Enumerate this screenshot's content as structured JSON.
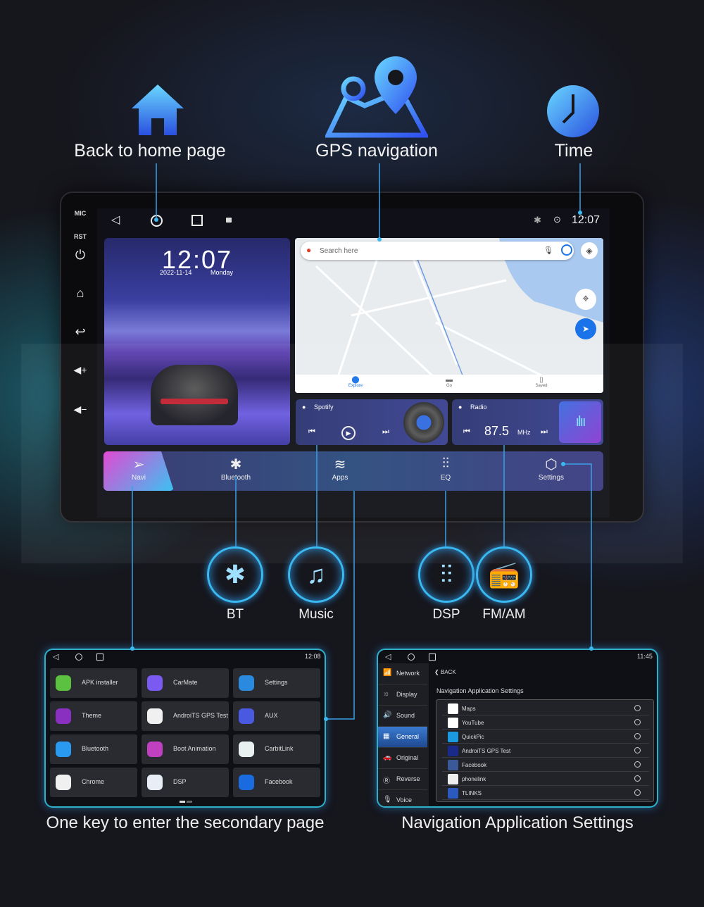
{
  "top_features": [
    {
      "label": "Back to home page",
      "icon": "home-icon"
    },
    {
      "label": "GPS navigation",
      "icon": "map-pin-icon"
    },
    {
      "label": "Time",
      "icon": "clock-icon"
    }
  ],
  "device": {
    "side_buttons": {
      "mic": "MIC",
      "rst": "RST"
    },
    "status_time": "12:07",
    "clock": {
      "time": "12:07",
      "date": "2022-11-14",
      "day": "Monday"
    },
    "map": {
      "search_placeholder": "Search here",
      "tabs": [
        "Explore",
        "Go",
        "Saved"
      ]
    },
    "spotify": {
      "title": "Spotify"
    },
    "radio": {
      "title": "Radio",
      "frequency": "87.5",
      "unit": "MHz"
    },
    "dock": [
      "Navi",
      "Bluetooth",
      "Apps",
      "EQ",
      "Settings"
    ]
  },
  "feature_icons": [
    {
      "label": "BT",
      "icon": "bluetooth-icon"
    },
    {
      "label": "Music",
      "icon": "music-note-icon"
    },
    {
      "label": "DSP",
      "icon": "equalizer-icon"
    },
    {
      "label": "FM/AM",
      "icon": "radio-icon"
    }
  ],
  "apps_screen": {
    "time": "12:08",
    "apps": [
      "APK installer",
      "CarMate",
      "Settings",
      "Theme",
      "AndroiTS GPS Test",
      "AUX",
      "Bluetooth",
      "Boot Animation",
      "CarbitLink",
      "Chrome",
      "DSP",
      "Facebook"
    ],
    "caption": "One key to enter the secondary page"
  },
  "settings_screen": {
    "time": "11:45",
    "sidebar": [
      "Network",
      "Display",
      "Sound",
      "General",
      "Original",
      "Reverse",
      "Voice"
    ],
    "active": "General",
    "back": "BACK",
    "title": "Navigation Application Settings",
    "apps": [
      "Maps",
      "YouTube",
      "QuickPic",
      "AndroiTS GPS Test",
      "Facebook",
      "phonelink",
      "TLINKS"
    ],
    "caption": "Navigation Application Settings"
  },
  "colors": {
    "accent": "#3aa8f0",
    "background": "#16161d"
  }
}
